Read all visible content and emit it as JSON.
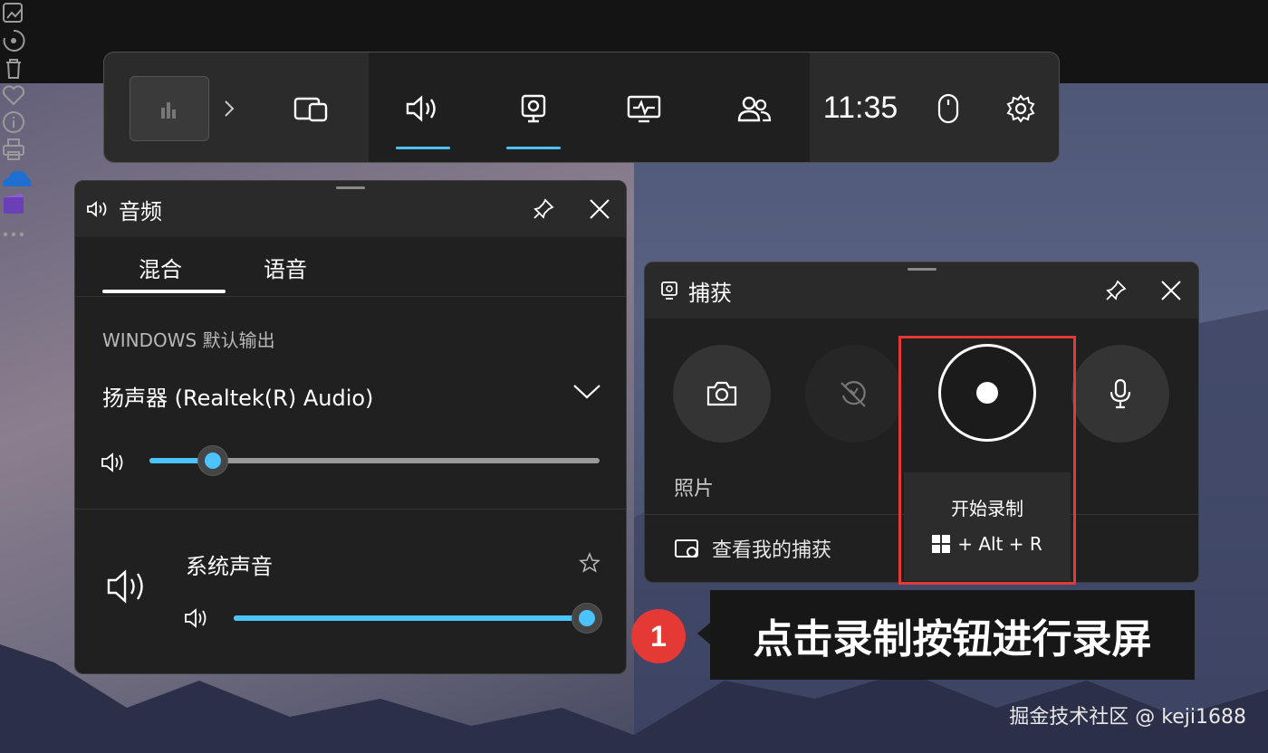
{
  "photos_toolbar": {
    "icons": [
      "edit-image-icon",
      "rotate-icon",
      "delete-icon",
      "favorite-icon",
      "info-icon",
      "print-icon",
      "onedrive-icon",
      "clipchamp-icon",
      "more-icon"
    ]
  },
  "gamebar": {
    "widgets": [
      "widget-menu-icon",
      "audio-icon",
      "capture-icon",
      "performance-icon",
      "social-icon"
    ],
    "clock": "11:35",
    "active_widgets": [
      "audio",
      "capture"
    ]
  },
  "audio_panel": {
    "title": "音频",
    "tabs": [
      {
        "label": "混合",
        "active": true
      },
      {
        "label": "语音",
        "active": false
      }
    ],
    "section_label": "WINDOWS 默认输出",
    "device": "扬声器 (Realtek(R) Audio)",
    "master_volume": 0.14,
    "apps": [
      {
        "name": "系统声音",
        "volume": 1.0
      }
    ]
  },
  "capture_panel": {
    "title": "捕获",
    "screenshot_label": "照片",
    "view_captures_label": "查看我的捕获",
    "tooltip_title": "开始录制",
    "tooltip_shortcut": "+ Alt + R"
  },
  "annotation": {
    "step": "1",
    "text": "点击录制按钮进行录屏"
  },
  "watermark": "掘金技术社区 @ keji1688",
  "colors": {
    "accent": "#4cc2ff",
    "highlight": "#e53935",
    "panel_bg": "#202020"
  }
}
